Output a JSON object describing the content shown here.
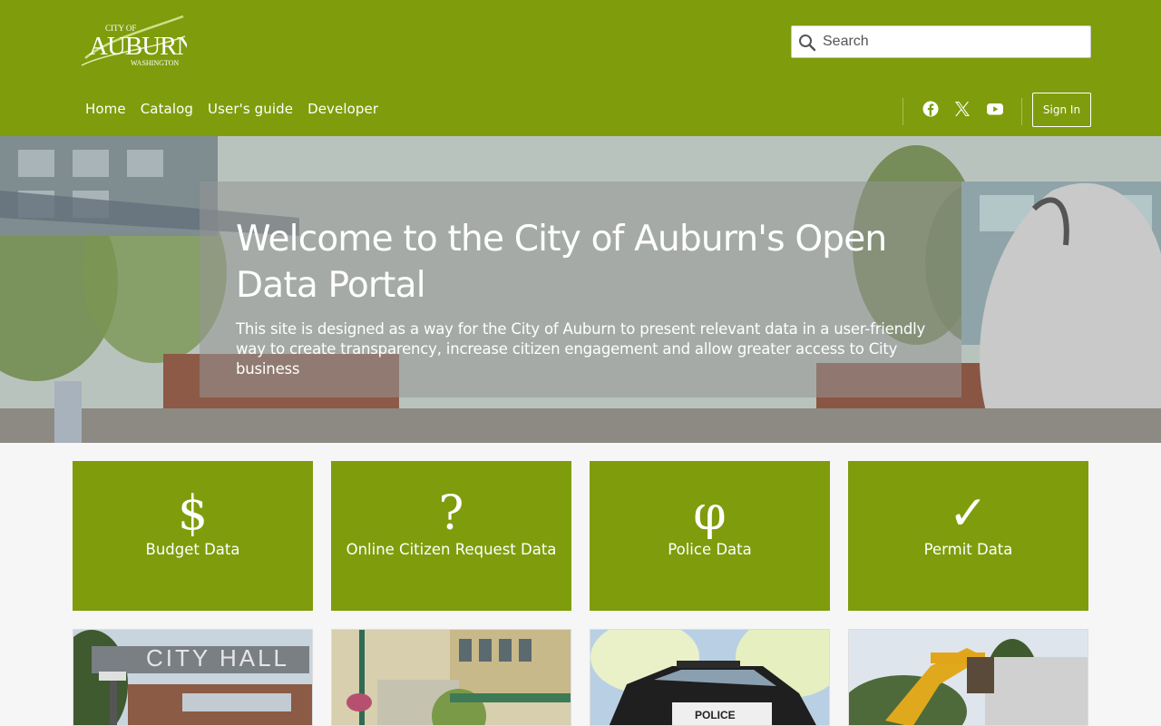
{
  "logo": {
    "line1": "CITY OF",
    "line2": "AUBURN",
    "line3": "WASHINGTON"
  },
  "search": {
    "placeholder": "Search",
    "value": ""
  },
  "nav": {
    "items": [
      {
        "label": "Home"
      },
      {
        "label": "Catalog"
      },
      {
        "label": "User's guide"
      },
      {
        "label": "Developer"
      }
    ]
  },
  "social": {
    "icons": [
      "facebook-icon",
      "x-twitter-icon",
      "youtube-icon"
    ]
  },
  "signin_label": "Sign In",
  "hero": {
    "title": "Welcome to the City of Auburn's Open Data Portal",
    "text": "This site is designed as a way for the City of Auburn to present relevant data in a user-friendly way to create transparency, increase citizen engagement and allow greater access to City business"
  },
  "tiles": [
    {
      "icon": "$",
      "label": "Budget Data"
    },
    {
      "icon": "?",
      "label": "Online Citizen Request Data"
    },
    {
      "icon": "φ",
      "label": "Police Data"
    },
    {
      "icon": "✓",
      "label": "Permit Data"
    }
  ],
  "photos": {
    "city_hall_sign": "CITY HALL",
    "police_text": "POLICE"
  },
  "colors": {
    "brand_green": "#7f9c0c",
    "white": "#ffffff",
    "page_bg": "#f6f6f6"
  }
}
